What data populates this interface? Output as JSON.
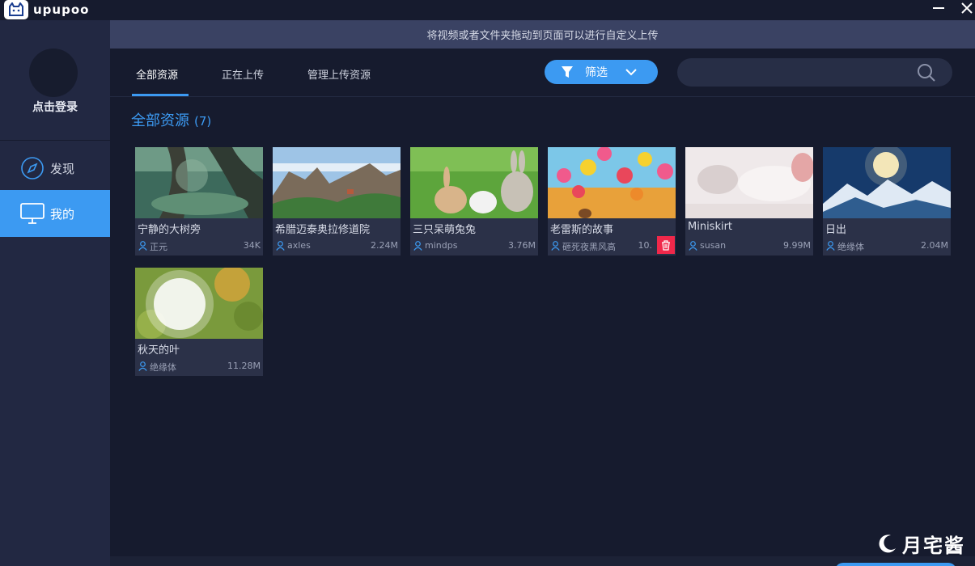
{
  "app": {
    "name": "upupoo",
    "window_controls": {
      "minimize_icon": "minimize-icon",
      "close_icon": "close-icon"
    }
  },
  "sidebar": {
    "login_label": "点击登录",
    "items": [
      {
        "label": "发现",
        "icon": "compass-icon",
        "active": false
      },
      {
        "label": "我的",
        "icon": "monitor-icon",
        "active": true
      }
    ]
  },
  "banner": {
    "text": "将视频或者文件夹拖动到页面可以进行自定义上传"
  },
  "tabs": [
    {
      "label": "全部资源",
      "active": true
    },
    {
      "label": "正在上传",
      "active": false
    },
    {
      "label": "管理上传资源",
      "active": false
    }
  ],
  "filter": {
    "label": "筛选",
    "icon": "filter-icon",
    "dropdown_icon": "chevron-down-icon"
  },
  "search": {
    "value": "",
    "placeholder": "",
    "icon": "search-icon"
  },
  "section": {
    "title": "全部资源",
    "count": "(7)"
  },
  "resources": [
    {
      "title": "宁静的大树旁",
      "author": "正元",
      "size": "34K"
    },
    {
      "title": "希腊迈泰奥拉修道院",
      "author": "axles",
      "size": "2.24M"
    },
    {
      "title": "三只呆萌兔兔",
      "author": "mindps",
      "size": "3.76M"
    },
    {
      "title": "老雷斯的故事",
      "author": "砸死夜黑风高",
      "size": "10."
    },
    {
      "title": "Miniskirt",
      "author": "susan",
      "size": "9.99M"
    },
    {
      "title": "日出",
      "author": "绝缘体",
      "size": "2.04M"
    },
    {
      "title": "秋天的叶",
      "author": "绝缘体",
      "size": "11.28M"
    }
  ],
  "watermark": {
    "text": "月宅酱"
  },
  "colors": {
    "accent": "#3c9af2",
    "delete": "#f0284a",
    "background": "#161b2e",
    "sidebar": "#222842"
  }
}
